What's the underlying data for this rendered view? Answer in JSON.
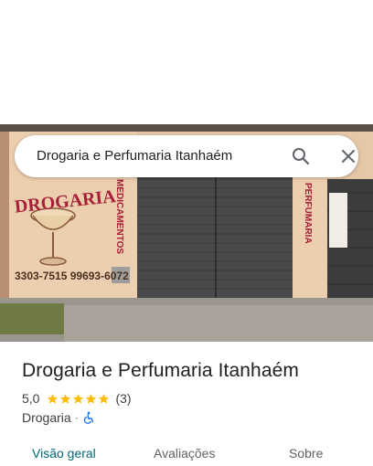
{
  "search": {
    "query": "Drogaria e Perfumaria Itanhaém"
  },
  "photo": {
    "sign_drogaria": "DROGARIA",
    "sign_medicamentos": "MEDICAMENTOS",
    "sign_perfumaria": "PERFUMARIA",
    "sign_phones": "3303-7515 99693-6072"
  },
  "place": {
    "name": "Drogaria e Perfumaria Itanhaém",
    "rating": "5,0",
    "stars": 5,
    "review_count": "(3)",
    "category": "Drogaria",
    "separator": "·",
    "star_color": "#fbbc04"
  },
  "tabs": [
    {
      "label": "Visão geral",
      "active": true
    },
    {
      "label": "Avaliações",
      "active": false
    },
    {
      "label": "Sobre",
      "active": false
    }
  ],
  "colors": {
    "accent": "#006a75",
    "text": "#202124"
  }
}
